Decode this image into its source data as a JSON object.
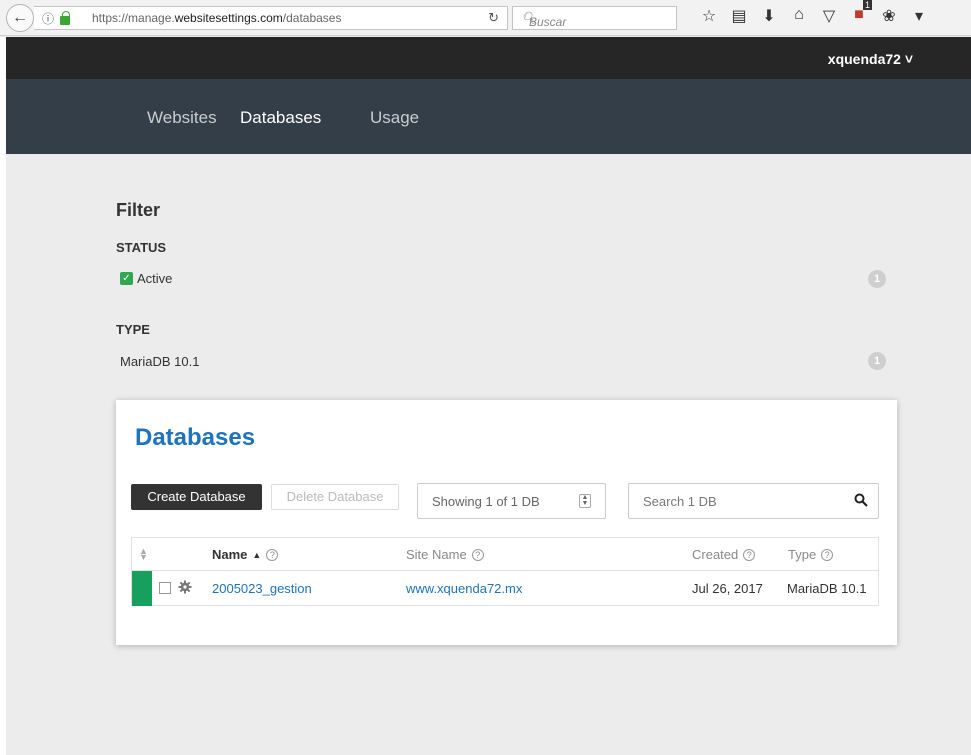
{
  "browser": {
    "url_prefix": "https://manage.",
    "url_domain": "websitesettings.com",
    "url_path": "/databases",
    "search_placeholder": "Buscar",
    "ublock_count": "1"
  },
  "header": {
    "username": "xquenda72 ˅",
    "nav": [
      {
        "label": "Websites",
        "active": false
      },
      {
        "label": "Databases",
        "active": true
      },
      {
        "label": "Usage",
        "active": false
      }
    ]
  },
  "filter": {
    "title": "Filter",
    "status_label": "STATUS",
    "status_option": "Active",
    "status_count": "1",
    "type_label": "TYPE",
    "type_option": "MariaDB 10.1",
    "type_count": "1"
  },
  "databases": {
    "title": "Databases",
    "create_button": "Create Database",
    "delete_button": "Delete Database",
    "showing": "Showing 1 of 1 DB",
    "search_placeholder": "Search 1 DB",
    "columns": {
      "name": "Name",
      "site": "Site Name",
      "created": "Created",
      "type": "Type"
    },
    "rows": [
      {
        "name": "2005023_gestion",
        "site": "www.xquenda72.mx",
        "created": "Jul 26, 2017",
        "type": "MariaDB 10.1",
        "status_color": "#17a05d"
      }
    ]
  },
  "colors": {
    "accent": "#1e73be",
    "nav_bg": "#333e48",
    "topbar_bg": "#262626",
    "active_green": "#17a05d"
  }
}
